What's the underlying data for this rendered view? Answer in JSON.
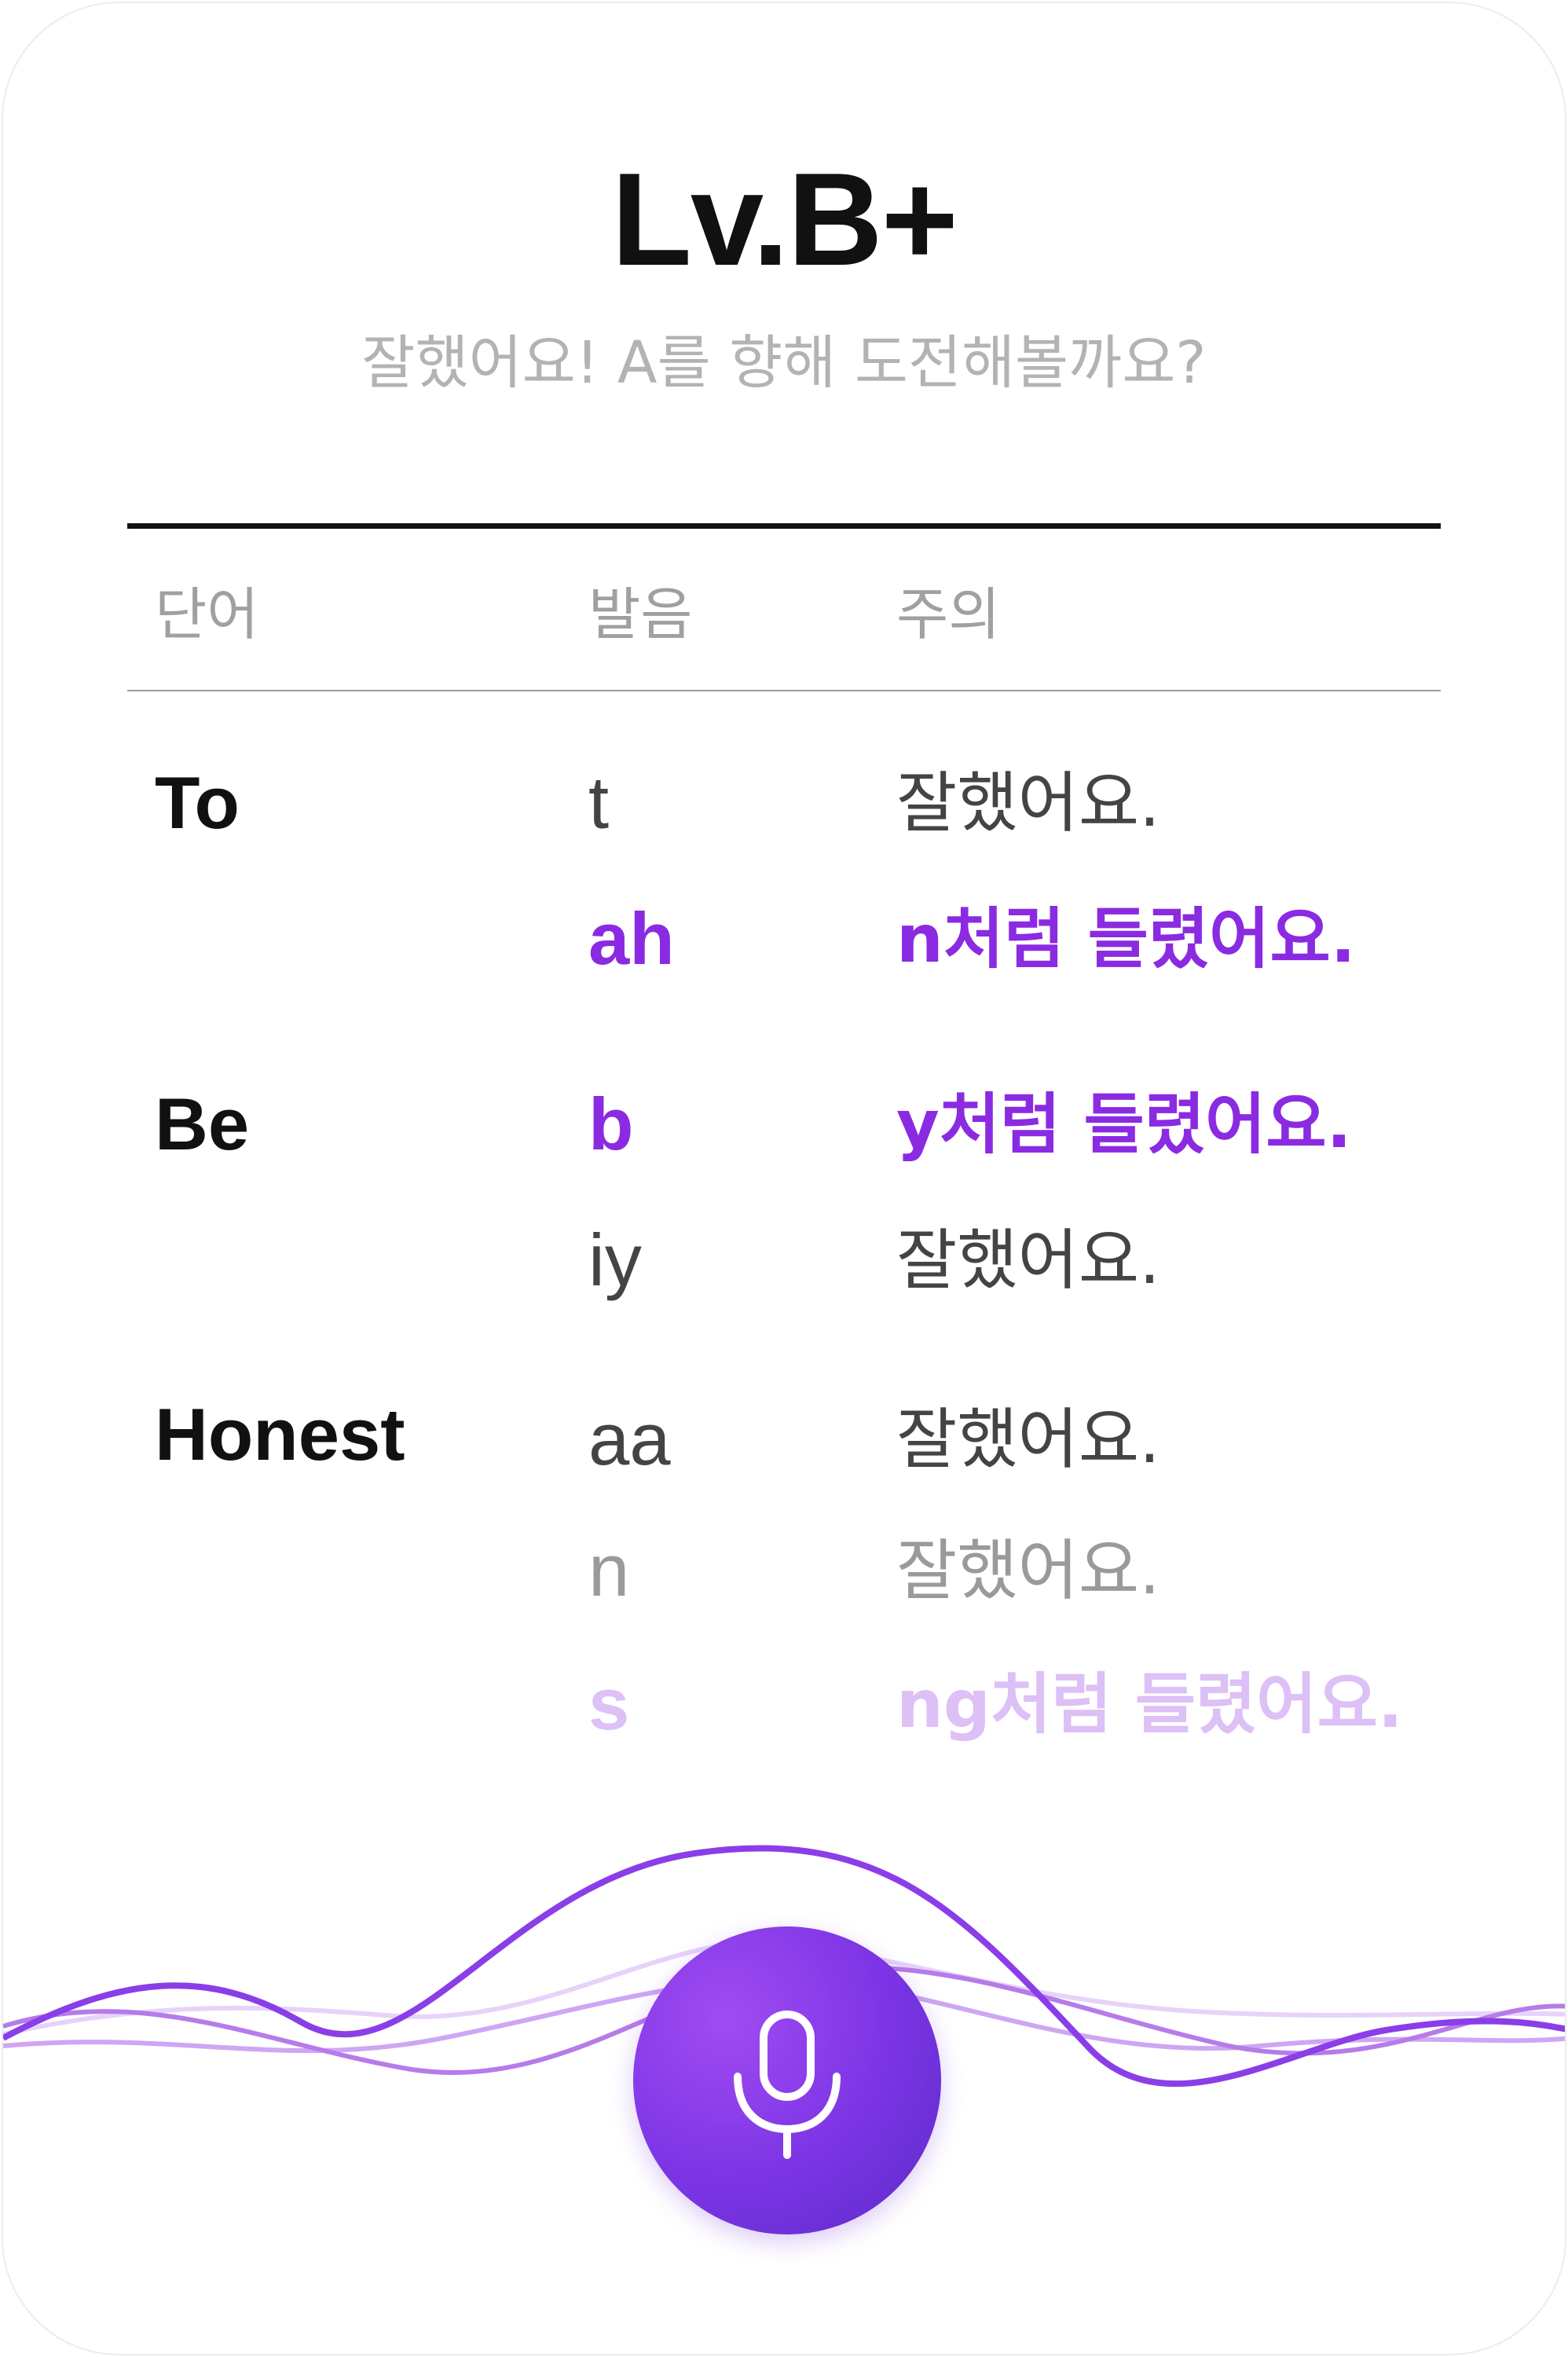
{
  "result": {
    "level": "Lv.B+",
    "message": "잘했어요! A를 향해 도전해볼까요?"
  },
  "table": {
    "headers": {
      "word": "단어",
      "phoneme": "발음",
      "note": "주의"
    },
    "rows": [
      {
        "word": "To",
        "phoneme": "t",
        "note": "잘했어요."
      },
      {
        "word": "",
        "phoneme": "ah",
        "note": "n처럼 들렸어요."
      },
      {
        "word": "Be",
        "phoneme": "b",
        "note": "y처럼 들렸어요."
      },
      {
        "word": "",
        "phoneme": "iy",
        "note": "잘했어요."
      },
      {
        "word": "Honest",
        "phoneme": "aa",
        "note": "잘했어요."
      },
      {
        "word": "",
        "phoneme": "n",
        "note": "잘했어요."
      },
      {
        "word": "",
        "phoneme": "s",
        "note": "ng처럼 들렸어요."
      }
    ]
  },
  "icons": {
    "mic": "microphone-icon"
  },
  "colors": {
    "accent": "#8a2be2",
    "accent_faded": "#dcc0f6",
    "text_primary": "#111111",
    "text_secondary": "#444444",
    "text_muted": "#9a9a9a"
  }
}
